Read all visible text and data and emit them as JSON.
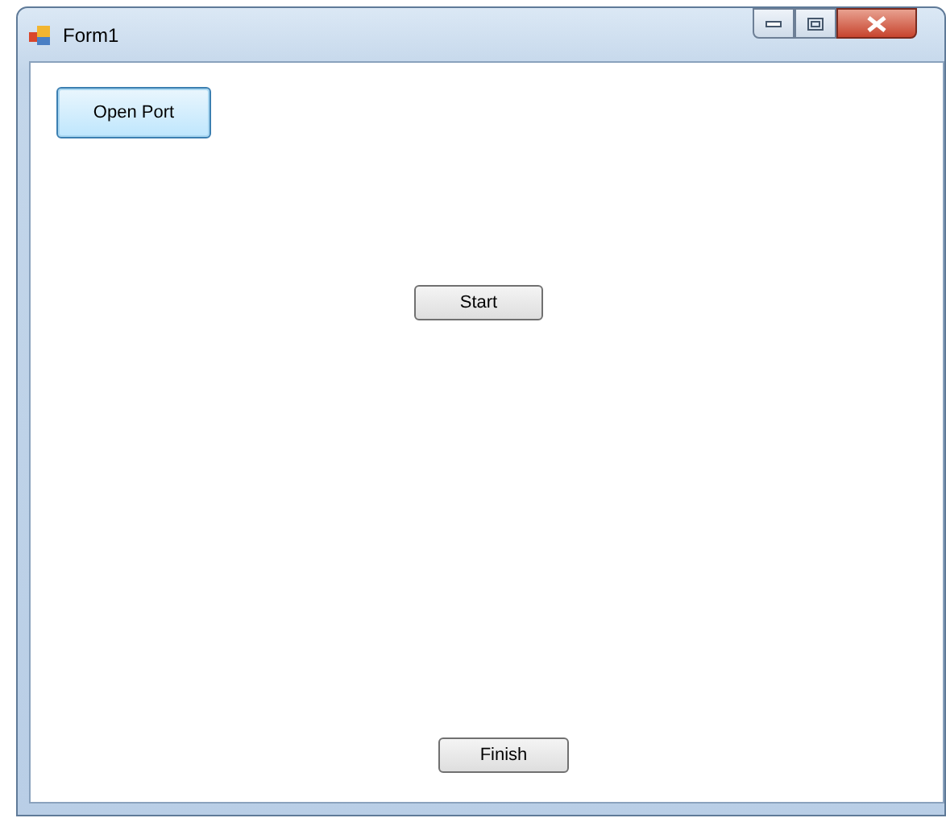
{
  "window": {
    "title": "Form1"
  },
  "buttons": [
    {
      "label": "Open Port",
      "focused": true
    },
    {
      "label": "Start",
      "focused": false
    },
    {
      "label": "Finish",
      "focused": false
    }
  ]
}
